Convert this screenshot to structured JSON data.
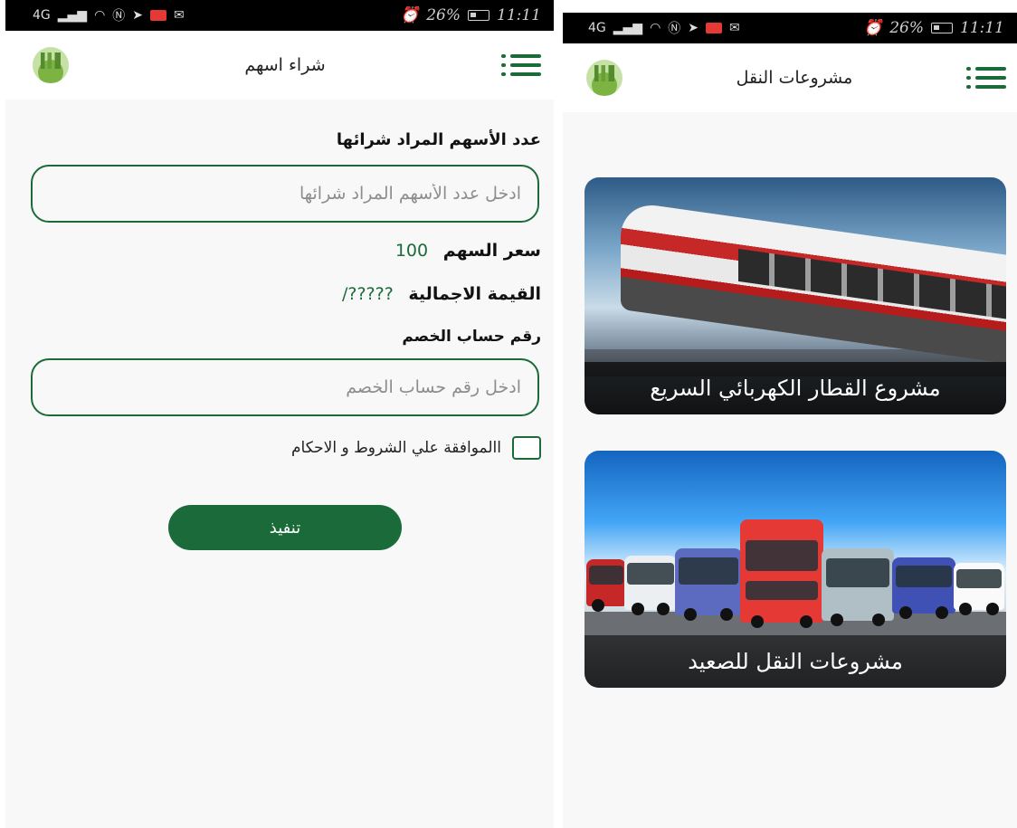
{
  "status_bar": {
    "network": "4G",
    "alarm_icon": "alarm-icon",
    "battery": "26%",
    "time": "11:11"
  },
  "left_screen": {
    "title": "شراء اسهم",
    "shares_label": "عدد الأسهم المراد شرائها",
    "shares_placeholder": "ادخل عدد الأسهم المراد شرائها",
    "price_label": "سعر السهم",
    "price_value": "100",
    "total_label": "القيمة الاجمالية",
    "total_value": "?????/",
    "account_label": "رقم حساب الخصم",
    "account_placeholder": "ادخل رقم حساب الخصم",
    "terms_label": "االموافقة علي الشروط و الاحكام",
    "submit_label": "تنفيذ"
  },
  "right_screen": {
    "title": "مشروعات النقل",
    "cards": [
      {
        "label": "مشروع القطار الكهربائي السريع",
        "image": "electric-train-image"
      },
      {
        "label": "مشروعات النقل للصعيد",
        "image": "buses-image"
      }
    ]
  },
  "colors": {
    "primary_green": "#1b6b3a",
    "status_bar": "#000000",
    "background": "#f8f8f8"
  }
}
